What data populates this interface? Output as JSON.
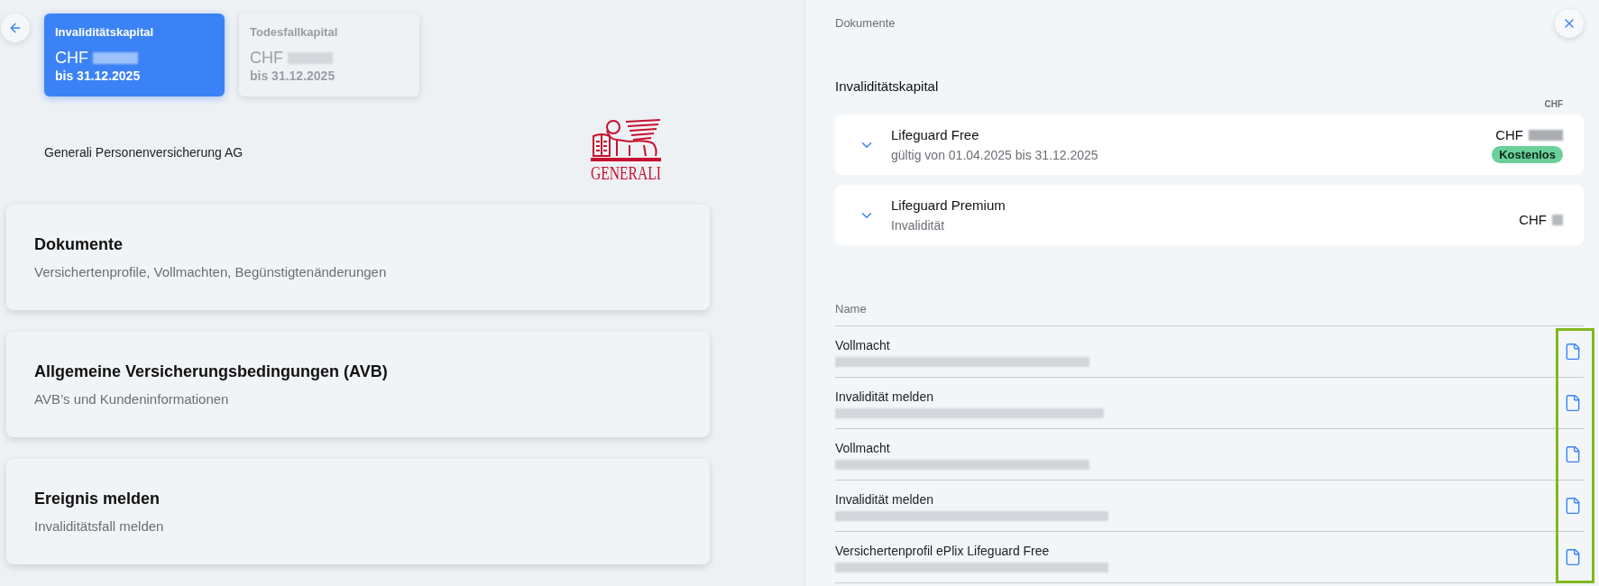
{
  "capital_tabs": [
    {
      "label": "Invaliditätskapital",
      "currency": "CHF",
      "valid_until": "bis 31.12.2025",
      "selected": true
    },
    {
      "label": "Todesfallkapital",
      "currency": "CHF",
      "valid_until": "bis 31.12.2025",
      "selected": false
    }
  ],
  "insurer": {
    "name": "Generali Personenversicherung AG",
    "logo_text": "GENERALI"
  },
  "sections": [
    {
      "title": "Dokumente",
      "subtitle": "Versichertenprofile, Vollmachten, Begünstigtenänderungen"
    },
    {
      "title": "Allgemeine Versicherungsbedingungen (AVB)",
      "subtitle": "AVB’s und Kundeninformationen"
    },
    {
      "title": "Ereignis melden",
      "subtitle": "Invaliditätsfall melden"
    }
  ],
  "panel": {
    "title": "Dokumente",
    "group_title": "Invaliditätskapital",
    "amount_column": "CHF",
    "products": [
      {
        "name": "Lifeguard Free",
        "detail": "gültig von 01.04.2025 bis 31.12.2025",
        "currency": "CHF",
        "badge": "Kostenlos",
        "expanded": false
      },
      {
        "name": "Lifeguard Premium",
        "detail": "Invalidität",
        "currency": "CHF",
        "expanded": false
      }
    ],
    "table": {
      "columns": [
        "Name"
      ],
      "rows": [
        {
          "name": "Vollmacht"
        },
        {
          "name": "Invalidität melden"
        },
        {
          "name": "Vollmacht"
        },
        {
          "name": "Invalidität melden"
        },
        {
          "name": "Versichertenprofil ePlix Lifeguard Free"
        }
      ]
    }
  }
}
